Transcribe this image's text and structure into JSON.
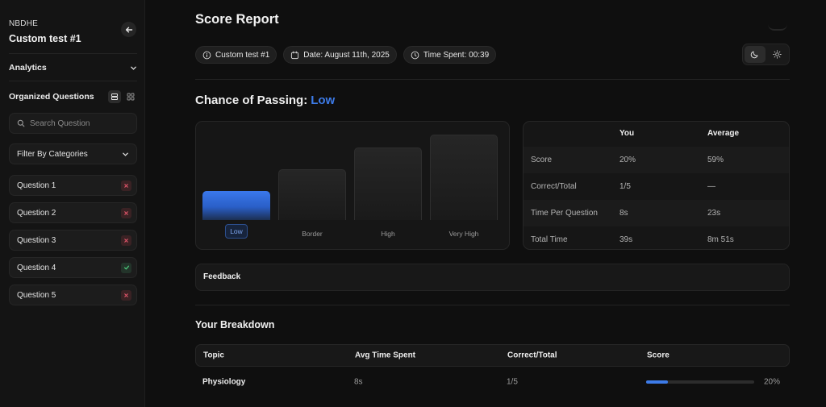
{
  "sidebar": {
    "brand": "NBDHE",
    "test_title": "Custom test #1",
    "analytics_label": "Analytics",
    "organized_label": "Organized Questions",
    "search_placeholder": "Search Question",
    "filter_label": "Filter By Categories",
    "questions": [
      {
        "label": "Question 1",
        "status": "incorrect"
      },
      {
        "label": "Question 2",
        "status": "incorrect"
      },
      {
        "label": "Question 3",
        "status": "incorrect"
      },
      {
        "label": "Question 4",
        "status": "correct"
      },
      {
        "label": "Question 5",
        "status": "incorrect"
      }
    ]
  },
  "header": {
    "title": "Score Report",
    "chips": {
      "test": "Custom test #1",
      "date": "Date: August 11th, 2025",
      "time": "Time Spent: 00:39"
    },
    "theme_mode": "dark"
  },
  "passing": {
    "label": "Chance of Passing:",
    "level": "Low",
    "bars": [
      {
        "label": "Low",
        "active": true
      },
      {
        "label": "Border",
        "active": false
      },
      {
        "label": "High",
        "active": false
      },
      {
        "label": "Very High",
        "active": false
      }
    ]
  },
  "stats": {
    "headers": [
      "",
      "You",
      "Average"
    ],
    "rows": [
      [
        "Score",
        "20%",
        "59%"
      ],
      [
        "Correct/Total",
        "1/5",
        "—"
      ],
      [
        "Time Per Question",
        "8s",
        "23s"
      ],
      [
        "Total Time",
        "39s",
        "8m 51s"
      ]
    ]
  },
  "feedback": {
    "label": "Feedback"
  },
  "breakdown": {
    "title": "Your Breakdown",
    "headers": [
      "Topic",
      "Avg Time Spent",
      "Correct/Total",
      "Score"
    ],
    "rows": [
      {
        "topic": "Physiology",
        "avg_time": "8s",
        "correct_total": "1/5",
        "score_pct": 20,
        "score_label": "20%"
      }
    ]
  },
  "colors": {
    "accent": "#3d7be8",
    "incorrect": "#e0556a",
    "correct": "#4cc77a"
  }
}
